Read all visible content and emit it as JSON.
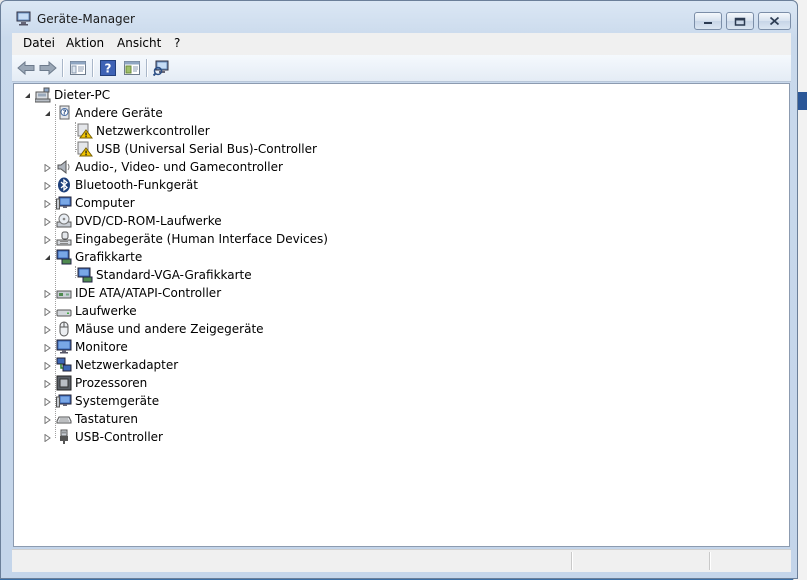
{
  "window": {
    "title": "Geräte-Manager"
  },
  "menu": {
    "items": [
      "Datei",
      "Aktion",
      "Ansicht",
      "?"
    ]
  },
  "toolbar": {
    "buttons": [
      "back-arrow-icon",
      "forward-arrow-icon",
      "properties-icon",
      "help-icon",
      "view-icon",
      "scan-hardware-icon"
    ]
  },
  "tree": {
    "root": "Dieter-PC",
    "andere_geraete": "Andere Geräte",
    "netzwerkcontroller": "Netzwerkcontroller",
    "usb_controller_unknown": "USB (Universal Serial Bus)-Controller",
    "audio": "Audio-, Video- und Gamecontroller",
    "bluetooth": "Bluetooth-Funkgerät",
    "computer": "Computer",
    "dvd": "DVD/CD-ROM-Laufwerke",
    "eingabe": "Eingabegeräte (Human Interface Devices)",
    "grafikkarte": "Grafikkarte",
    "standard_vga": "Standard-VGA-Grafikkarte",
    "ide": "IDE ATA/ATAPI-Controller",
    "laufwerke": "Laufwerke",
    "maeuse": "Mäuse und andere Zeigegeräte",
    "monitore": "Monitore",
    "netzwerkadapter": "Netzwerkadapter",
    "prozessoren": "Prozessoren",
    "systemgeraete": "Systemgeräte",
    "tastaturen": "Tastaturen",
    "usb_controller": "USB-Controller"
  },
  "colors": {
    "accent": "#2b5797",
    "warning": "#f2c500",
    "title_bg": "#c9d9ec"
  }
}
